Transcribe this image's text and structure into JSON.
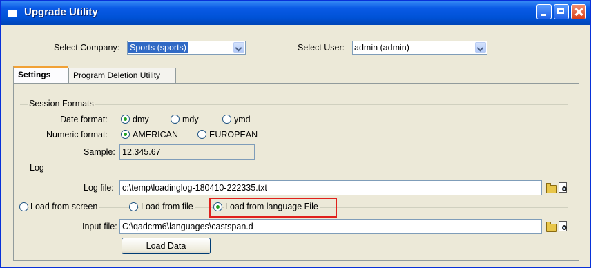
{
  "window": {
    "title": "Upgrade Utility"
  },
  "header": {
    "company_label": "Select Company:",
    "company_value": "Sports (sports)",
    "user_label": "Select User:",
    "user_value": "admin (admin)"
  },
  "tabs": [
    {
      "label": "Settings",
      "active": true
    },
    {
      "label": "Program Deletion Utility",
      "active": false
    }
  ],
  "session_formats": {
    "title": "Session Formats",
    "date_format_label": "Date format:",
    "date_options": [
      "dmy",
      "mdy",
      "ymd"
    ],
    "date_selected": "dmy",
    "numeric_format_label": "Numeric format:",
    "numeric_options": [
      "AMERICAN",
      "EUROPEAN"
    ],
    "numeric_selected": "AMERICAN",
    "sample_label": "Sample:",
    "sample_value": "12,345.67"
  },
  "log": {
    "title": "Log",
    "log_file_label": "Log file:",
    "log_file_value": "c:\\temp\\loadinglog-180410-222335.txt"
  },
  "load_source": {
    "options": [
      "Load from screen",
      "Load from file",
      "Load from language File"
    ],
    "selected": "Load from language File",
    "input_file_label": "Input file:",
    "input_file_value": "C:\\qadcrm6\\languages\\castspan.d",
    "load_button": "Load Data"
  },
  "icons": {
    "browse": "folder-open-icon",
    "view": "view-file-icon"
  },
  "colors": {
    "titlebar": "#0a5ae6",
    "selection": "#316ac5",
    "highlight_box": "#e0201b",
    "radio_dot": "#21a121"
  }
}
